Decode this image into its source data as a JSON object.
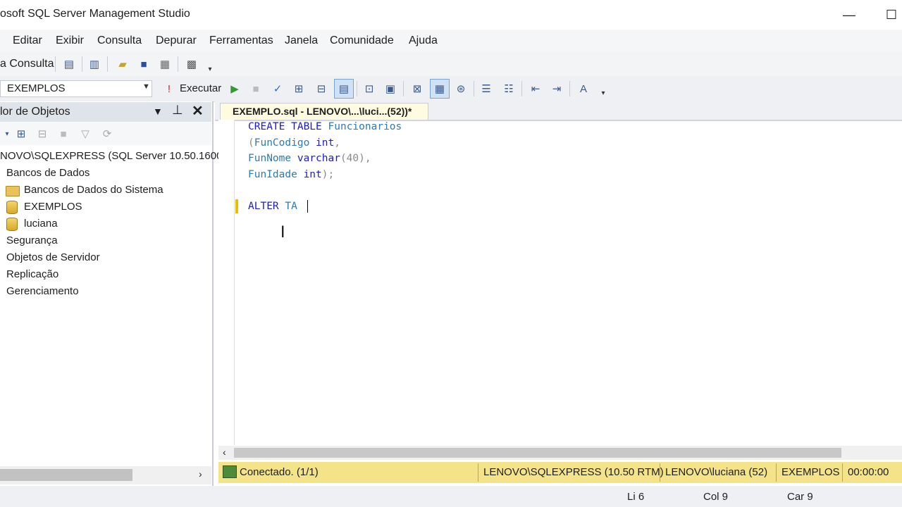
{
  "window": {
    "title": "osoft SQL Server Management Studio",
    "minimize_glyph": "—",
    "maximize_glyph": "☐"
  },
  "menu": [
    "Editar",
    "Exibir",
    "Consulta",
    "Depurar",
    "Ferramentas",
    "Janela",
    "Comunidade",
    "Ajuda"
  ],
  "toolbar1": {
    "new_query_label": "a Consulta"
  },
  "toolbar2": {
    "database": "EXEMPLOS",
    "execute_label": "Executar"
  },
  "object_explorer": {
    "title": "lor de Objetos",
    "server": "NOVO\\SQLEXPRESS (SQL Server 10.50.1600",
    "nodes": {
      "databases": "Bancos de Dados",
      "system_databases": "Bancos de Dados do Sistema",
      "db_exemplos": "EXEMPLOS",
      "db_luciana": "luciana",
      "security": "Segurança",
      "server_objects": "Objetos de Servidor",
      "replication": "Replicação",
      "management": "Gerenciamento"
    }
  },
  "editor": {
    "tab_title": "EXEMPLO.sql - LENOVO\\...\\luci...(52))*",
    "code": {
      "l1_kw": "CREATE TABLE",
      "l1_id": "Funcionarios",
      "l2_a": "(",
      "l2_id": "FunCodigo",
      "l2_kw": "int",
      "l2_b": ",",
      "l3_id": "FunNome",
      "l3_kw": "varchar",
      "l3_b": "(40),",
      "l4_id": "FunIdade",
      "l4_kw": "int",
      "l4_b": ");",
      "l6_kw": "ALTER",
      "l6_partial": "TA"
    }
  },
  "query_status": {
    "connection": "Conectado. (1/1)",
    "server": "LENOVO\\SQLEXPRESS (10.50 RTM)",
    "user": "LENOVO\\luciana (52)",
    "database": "EXEMPLOS",
    "elapsed": "00:00:00"
  },
  "status": {
    "line": "Li 6",
    "col": "Col 9",
    "char": "Car 9"
  },
  "colors": {
    "keyword": "#1a1ad6",
    "identifier": "#2d7bb0",
    "status_bar": "#f5e38a"
  }
}
